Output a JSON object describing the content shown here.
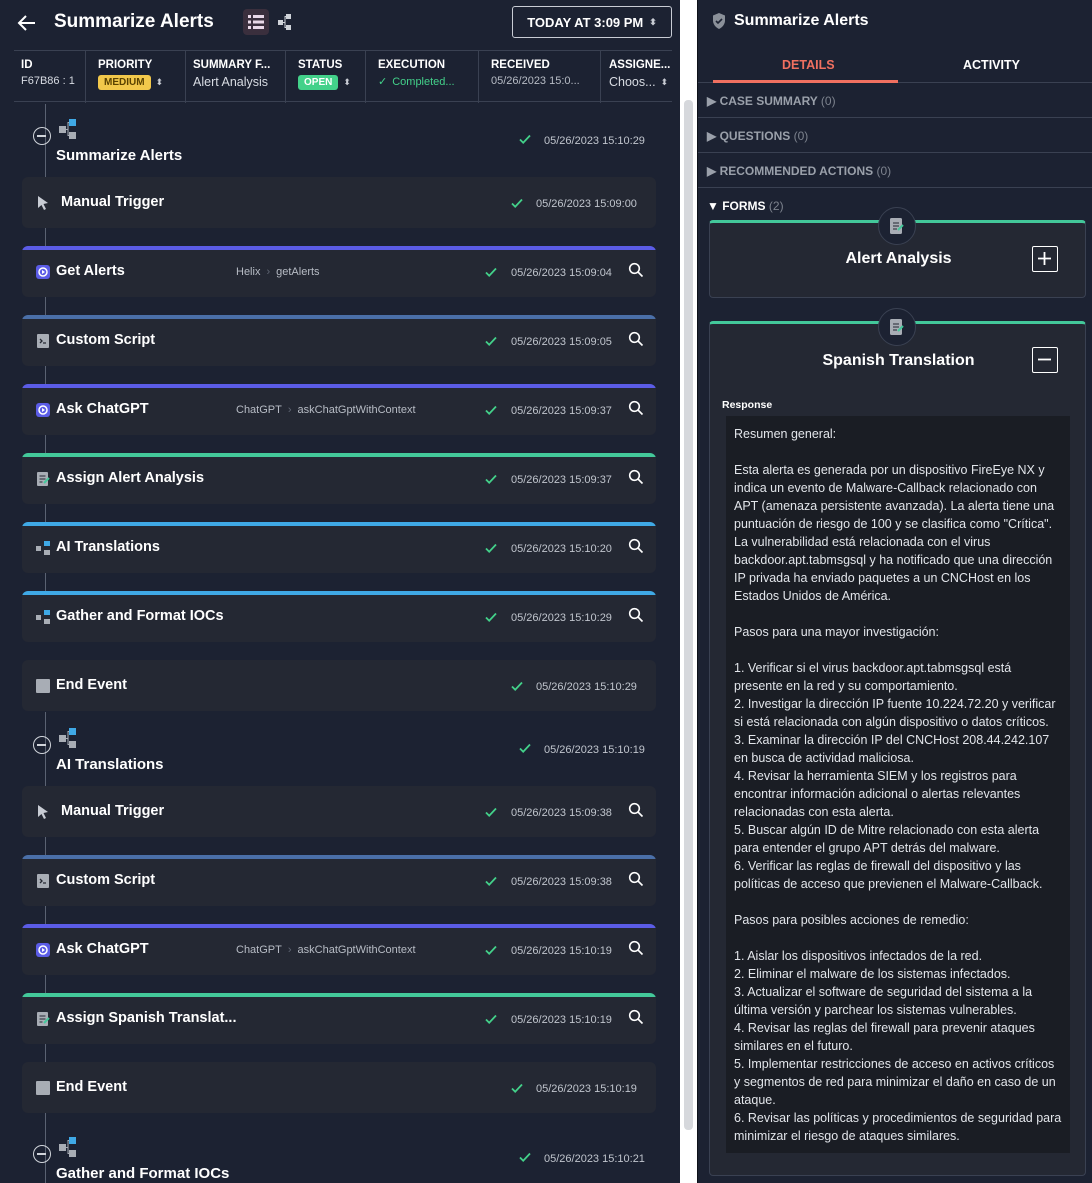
{
  "header": {
    "title": "Summarize Alerts",
    "date_button": "TODAY AT 3:09 PM"
  },
  "fields": [
    {
      "label": "ID",
      "value": "F67B86 : 1"
    },
    {
      "label": "PRIORITY",
      "value": "MEDIUM"
    },
    {
      "label": "SUMMARY F...",
      "value": "Alert Analysis"
    },
    {
      "label": "STATUS",
      "value": "OPEN"
    },
    {
      "label": "EXECUTION",
      "value": "Completed..."
    },
    {
      "label": "RECEIVED",
      "value": "05/26/2023 15:0..."
    },
    {
      "label": "ASSIGNE...",
      "value": "Choos..."
    }
  ],
  "groups": [
    {
      "title": "Summarize Alerts",
      "time": "05/26/2023 15:10:29"
    },
    {
      "title": "AI Translations",
      "time": "05/26/2023 15:10:19"
    },
    {
      "title": "Gather and Format IOCs",
      "time": "05/26/2023 15:10:21"
    }
  ],
  "steps": [
    {
      "label": "Manual Trigger",
      "meta_app": "",
      "meta_action": "",
      "time": "05/26/2023 15:09:00",
      "icon": "cursor-icon",
      "bar": "",
      "search": false
    },
    {
      "label": "Get Alerts",
      "meta_app": "Helix",
      "meta_action": "getAlerts",
      "time": "05/26/2023 15:09:04",
      "icon": "integration-icon",
      "bar": "#5b5ce6",
      "search": true
    },
    {
      "label": "Custom Script",
      "meta_app": "",
      "meta_action": "",
      "time": "05/26/2023 15:09:05",
      "icon": "script-icon",
      "bar": "#4a6fa8",
      "search": true
    },
    {
      "label": "Ask ChatGPT",
      "meta_app": "ChatGPT",
      "meta_action": "askChatGptWithContext",
      "time": "05/26/2023 15:09:37",
      "icon": "integration-icon",
      "bar": "#5b5ce6",
      "search": true
    },
    {
      "label": "Assign Alert Analysis",
      "meta_app": "",
      "meta_action": "",
      "time": "05/26/2023 15:09:37",
      "icon": "form-icon",
      "bar": "#43c89a",
      "search": true
    },
    {
      "label": "AI Translations",
      "meta_app": "",
      "meta_action": "",
      "time": "05/26/2023 15:10:20",
      "icon": "subflow-icon",
      "bar": "#3fa9e6",
      "search": true
    },
    {
      "label": "Gather and Format IOCs",
      "meta_app": "",
      "meta_action": "",
      "time": "05/26/2023 15:10:29",
      "icon": "subflow-icon",
      "bar": "#3fa9e6",
      "search": true
    },
    {
      "label": "End Event",
      "meta_app": "",
      "meta_action": "",
      "time": "05/26/2023 15:10:29",
      "icon": "end-icon",
      "bar": "",
      "search": false
    },
    {
      "label": "Manual Trigger",
      "meta_app": "",
      "meta_action": "",
      "time": "05/26/2023 15:09:38",
      "icon": "cursor-icon",
      "bar": "",
      "search": true
    },
    {
      "label": "Custom Script",
      "meta_app": "",
      "meta_action": "",
      "time": "05/26/2023 15:09:38",
      "icon": "script-icon",
      "bar": "#4a6fa8",
      "search": true
    },
    {
      "label": "Ask ChatGPT",
      "meta_app": "ChatGPT",
      "meta_action": "askChatGptWithContext",
      "time": "05/26/2023 15:10:19",
      "icon": "integration-icon",
      "bar": "#5b5ce6",
      "search": true
    },
    {
      "label": "Assign Spanish Translat...",
      "meta_app": "",
      "meta_action": "",
      "time": "05/26/2023 15:10:19",
      "icon": "form-icon",
      "bar": "#43c89a",
      "search": true
    },
    {
      "label": "End Event",
      "meta_app": "",
      "meta_action": "",
      "time": "05/26/2023 15:10:19",
      "icon": "end-icon",
      "bar": "",
      "search": false
    }
  ],
  "panel": {
    "title": "Summarize Alerts",
    "tabs": [
      "DETAILS",
      "ACTIVITY"
    ],
    "sections": [
      {
        "label": "CASE SUMMARY",
        "count": "(0)"
      },
      {
        "label": "QUESTIONS",
        "count": "(0)"
      },
      {
        "label": "RECOMMENDED ACTIONS",
        "count": "(0)"
      },
      {
        "label": "FORMS",
        "count": "(2)"
      }
    ],
    "forms": [
      {
        "title": "Alert Analysis"
      },
      {
        "title": "Spanish Translation"
      }
    ],
    "response_label": "Response",
    "response_text": "Resumen general:\n\nEsta alerta es generada por un dispositivo FireEye NX y indica un evento de Malware-Callback relacionado con APT (amenaza persistente avanzada). La alerta tiene una puntuación de riesgo de 100 y se clasifica como \"Crítica\". La vulnerabilidad está relacionada con el virus backdoor.apt.tabmsgsql y ha notificado que una dirección IP privada ha enviado paquetes a un CNCHost en los Estados Unidos de América.\n\nPasos para una mayor investigación:\n\n1. Verificar si el virus backdoor.apt.tabmsgsql está presente en la red y su comportamiento.\n2. Investigar la dirección IP fuente 10.224.72.20 y verificar si está relacionada con algún dispositivo o datos críticos.\n3. Examinar la dirección IP del CNCHost 208.44.242.107 en busca de actividad maliciosa.\n4. Revisar la herramienta SIEM y los registros para encontrar información adicional o alertas relevantes relacionadas con esta alerta.\n5. Buscar algún ID de Mitre relacionado con esta alerta para entender el grupo APT detrás del malware.\n6. Verificar las reglas de firewall del dispositivo y las políticas de acceso que previenen el Malware-Callback.\n\nPasos para posibles acciones de remedio:\n\n1. Aislar los dispositivos infectados de la red.\n2. Eliminar el malware de los sistemas infectados.\n3. Actualizar el software de seguridad del sistema a la última versión y parchear los sistemas vulnerables.\n4. Revisar las reglas del firewall para prevenir ataques similares en el futuro.\n5. Implementar restricciones de acceso en activos críticos y segmentos de red para minimizar el daño en caso de un ataque.\n6. Revisar las políticas y procedimientos de seguridad para minimizar el riesgo de ataques similares."
  },
  "colors": {
    "background": "#1c2232",
    "card": "#242833",
    "accent_tab": "#f07060",
    "success": "#43d18a",
    "priority_medium": "#f2c84b"
  }
}
